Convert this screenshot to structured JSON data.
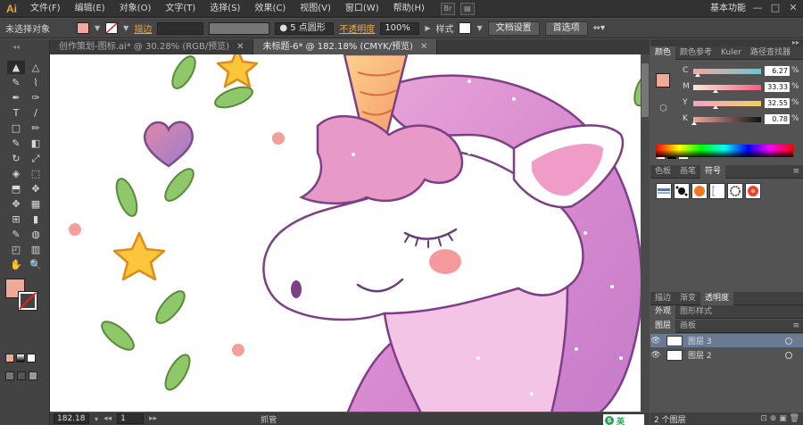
{
  "app": {
    "logo": "Ai",
    "workspace": "基本功能",
    "bridge_label": "Br"
  },
  "menu": [
    "文件(F)",
    "编辑(E)",
    "对象(O)",
    "文字(T)",
    "选择(S)",
    "效果(C)",
    "视图(V)",
    "窗口(W)",
    "帮助(H)"
  ],
  "window_controls": [
    "—",
    "□",
    "✕"
  ],
  "control_bar": {
    "selection_status": "未选择对象",
    "fill_color": "#f4a7a0",
    "stroke_label": "描边",
    "brush": "5 点圆形",
    "opacity_label": "不透明度",
    "opacity_value": "100%",
    "style_label": "样式",
    "doc_setup": "文档设置",
    "preferences": "首选项"
  },
  "doc_tabs": [
    {
      "label": "创作策划-图标.ai* @ 30.28% (RGB/预览)",
      "active": false
    },
    {
      "label": "未标题-6* @ 182.18% (CMYK/预览)",
      "active": true
    }
  ],
  "tools": [
    "▲",
    "△",
    "✎",
    "⌇",
    "✒",
    "✑",
    "T",
    "/",
    "□",
    "✏",
    "✎",
    "◧",
    "↻",
    "⤢",
    "◈",
    "⬚",
    "⬒",
    "✥",
    "✥",
    "▦",
    "⊞",
    "▮",
    "✎",
    "◍",
    "◰",
    "▥",
    "✋",
    "🔍"
  ],
  "fill_color": "#f0a898",
  "color_panel": {
    "tabs": [
      "颜色",
      "颜色参考",
      "Kuler",
      "路径查找器"
    ],
    "channels": [
      {
        "letter": "C",
        "value": "6.27",
        "level": 0.06,
        "gradient": "linear-gradient(to right,#f4a7a0,#6fc6d0)"
      },
      {
        "letter": "M",
        "value": "33.33",
        "level": 0.33,
        "gradient": "linear-gradient(to right,#f8e8d8,#f06080)"
      },
      {
        "letter": "Y",
        "value": "32.55",
        "level": 0.33,
        "gradient": "linear-gradient(to right,#f4a0c8,#f4d060)"
      },
      {
        "letter": "K",
        "value": "0.78",
        "level": 0.01,
        "gradient": "linear-gradient(to right,#f4a7a0,#111111)"
      }
    ],
    "percent": "%"
  },
  "swatch_panel": {
    "tabs": [
      "色板",
      "画笔",
      "符号"
    ]
  },
  "stroke_panel": {
    "tabs": [
      "描边",
      "渐变",
      "透明度"
    ]
  },
  "appearance_panel": {
    "tabs": [
      "外观",
      "图形样式"
    ]
  },
  "layers_panel": {
    "tabs": [
      "图层",
      "画板"
    ],
    "layers": [
      {
        "name": "图层 3",
        "selected": true
      },
      {
        "name": "图层 2",
        "selected": false
      }
    ],
    "footer": "2 个图层"
  },
  "status_bar": {
    "zoom": "182.18",
    "page": "1",
    "tool": "抓管"
  },
  "ime": {
    "label": "英"
  }
}
